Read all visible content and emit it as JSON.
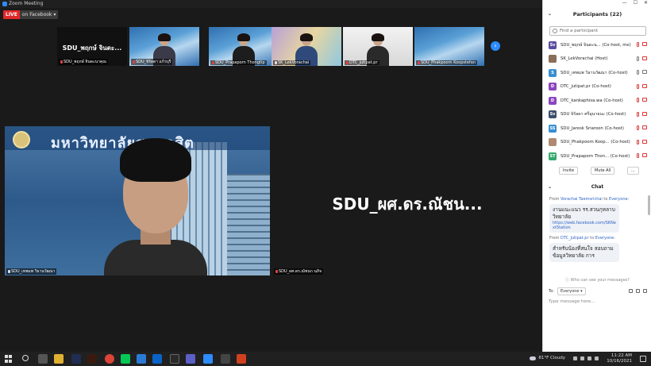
{
  "window": {
    "title": "Zoom Meeting"
  },
  "live": {
    "badge": "LIVE",
    "destination": "on Facebook"
  },
  "filmstrip": [
    {
      "name": "SDU_พฤกษ์ จินดะนาคุณ",
      "big_label": "SDU_พฤกษ์ จินดะ...",
      "muted": true,
      "type": "name"
    },
    {
      "name": "SDU_จิรัลดา แก้วบุรี",
      "muted": true,
      "type": "video"
    },
    {
      "name": "SDU_Prapaporn Thongtip",
      "muted": true,
      "type": "video"
    },
    {
      "name": "SK_LekVorachai",
      "muted": false,
      "type": "video"
    },
    {
      "name": "DTC_jutipat.pr",
      "muted": true,
      "type": "video"
    },
    {
      "name": "SDU_Phakpoom Koopstefan",
      "muted": true,
      "type": "video"
    }
  ],
  "main_video": {
    "name": "SDU_เทพแพ วิธานวัฒนา",
    "banner": "มหาวิทยาลัยสวนดุสิต"
  },
  "name_tile": {
    "label": "SDU_ผศ.ดร.ณัชน...",
    "name": "SDU_ผศ.ดร.ณัชนก นภิจ"
  },
  "participants": {
    "title": "Participants (22)",
    "search_placeholder": "Find a participant",
    "items": [
      {
        "initials": "Sv",
        "color": "#5a4da0",
        "name": "SDU_พฤกษ์ จินดะน... (Co-host, me)",
        "mic": "muted",
        "cam": "off"
      },
      {
        "initials": "",
        "color": "#8a6e58",
        "name": "SK_LekVorachai (Host)",
        "mic": "on",
        "cam": "off"
      },
      {
        "initials": "S",
        "color": "#3a8fd0",
        "name": "SDU_เทพแพ วิธานวัฒนา (Co-host)",
        "mic": "on",
        "cam": "on"
      },
      {
        "initials": "D",
        "color": "#8c45c0",
        "name": "DTC_jutipat.pr (Co-host)",
        "mic": "muted",
        "cam": "off"
      },
      {
        "initials": "D",
        "color": "#8c45c0",
        "name": "DTC_kankaphisa.wa (Co-host)",
        "mic": "muted",
        "cam": "off"
      },
      {
        "initials": "Sv",
        "color": "#3c4e6a",
        "name": "SDU จิรัลดา ศรีอุนาธนะ (Co-host)",
        "mic": "muted",
        "cam": "off"
      },
      {
        "initials": "SS",
        "color": "#3a8fd0",
        "name": "SDU_Jaresk Sriaroon (Co-host)",
        "mic": "muted",
        "cam": "off"
      },
      {
        "initials": "",
        "color": "#b08a70",
        "name": "SDU_Phakpoom Koop... (Co-host)",
        "mic": "muted",
        "cam": "off"
      },
      {
        "initials": "ST",
        "color": "#33a86a",
        "name": "SDU_Prapaporn Thon... (Co-host)",
        "mic": "muted",
        "cam": "off"
      }
    ],
    "invite_label": "Invite",
    "mute_all_label": "Mute All",
    "more_label": "..."
  },
  "chat": {
    "title": "Chat",
    "messages": [
      {
        "from": "Vorachai Taemsrichai",
        "to": "Everyone",
        "text": "งานแนะแนว รร.สวนกุหลาบวิทยาลัย",
        "link": "https://web.facebook.com/SKNextStation"
      },
      {
        "from": "DTC_jutipat.pr",
        "to": "Everyone",
        "text": "สำหรับน้องที่สนใจ สอบถามข้อมูลวิทยาลัย การ",
        "link": ""
      }
    ],
    "from_label": "From",
    "to_label": "to",
    "who_can_see": "Who can see your messages?",
    "to_prefix": "To:",
    "recipient": "Everyone",
    "input_placeholder": "Type message here..."
  },
  "taskbar": {
    "weather": "81°F  Cloudy",
    "time": "11:22 AM",
    "date": "10/16/2021"
  }
}
